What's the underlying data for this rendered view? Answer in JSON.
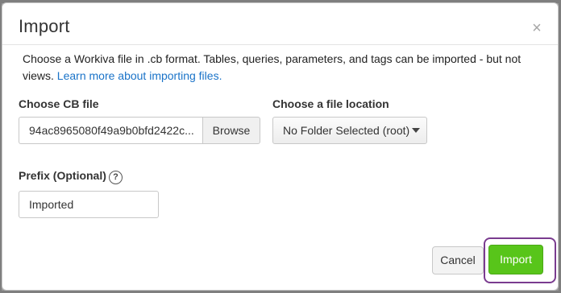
{
  "dialog": {
    "title": "Import",
    "close_glyph": "×",
    "description_text": "Choose a Workiva file in .cb format. Tables, queries, parameters, and tags can be imported - but not views.",
    "learn_more_link": "Learn more about importing files."
  },
  "cb_file": {
    "label": "Choose CB file",
    "value": "94ac8965080f49a9b0bfd2422c...",
    "browse_label": "Browse"
  },
  "location": {
    "label": "Choose a file location",
    "selected": "No Folder Selected (root)"
  },
  "prefix": {
    "label": "Prefix (Optional)",
    "help_glyph": "?",
    "value": "Imported"
  },
  "footer": {
    "cancel_label": "Cancel",
    "import_label": "Import"
  },
  "colors": {
    "accent_green": "#58c51a",
    "link_blue": "#1a73c8",
    "highlight_purple": "#7a3b8f"
  }
}
